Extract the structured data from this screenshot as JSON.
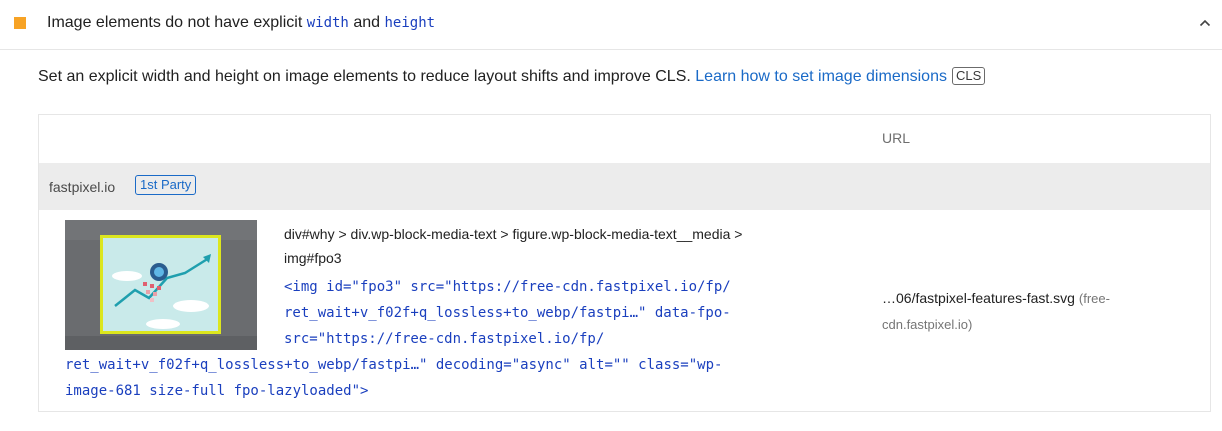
{
  "audit": {
    "title_prefix": "Image elements do not have explicit",
    "code_width": "width",
    "and_text": "and",
    "code_height": "height"
  },
  "description": {
    "text": "Set an explicit width and height on image elements to reduce layout shifts and improve CLS.",
    "link_text": "Learn how to set image dimensions",
    "badge": "CLS"
  },
  "table": {
    "column_url": "URL",
    "group": {
      "name": "fastpixel.io",
      "badge": "1st Party"
    },
    "row": {
      "selector_line1": "div#why > div.wp-block-media-text > figure.wp-block-media-text__media >",
      "selector_line2": "img#fpo3",
      "snippet": [
        "<img id=\"fpo3\" src=\"https://free-cdn.fastpixel.io/fp/",
        "ret_wait+v_f02f+q_lossless+to_webp/fastpi…\" data-fpo-",
        "src=\"https://free-cdn.fastpixel.io/fp/",
        "ret_wait+v_f02f+q_lossless+to_webp/fastpi…\" decoding=\"async\" alt=\"\" class=\"wp-",
        "image-681 size-full fpo-lazyloaded\">"
      ],
      "url_main": "…06/fastpixel-features-fast.svg",
      "url_host_line1": "(free-",
      "url_host_line2": "cdn.fastpixel.io)"
    }
  },
  "colors": {
    "warning": "#f7a325",
    "link": "#1a6ac7",
    "code": "#1a3fbe"
  }
}
